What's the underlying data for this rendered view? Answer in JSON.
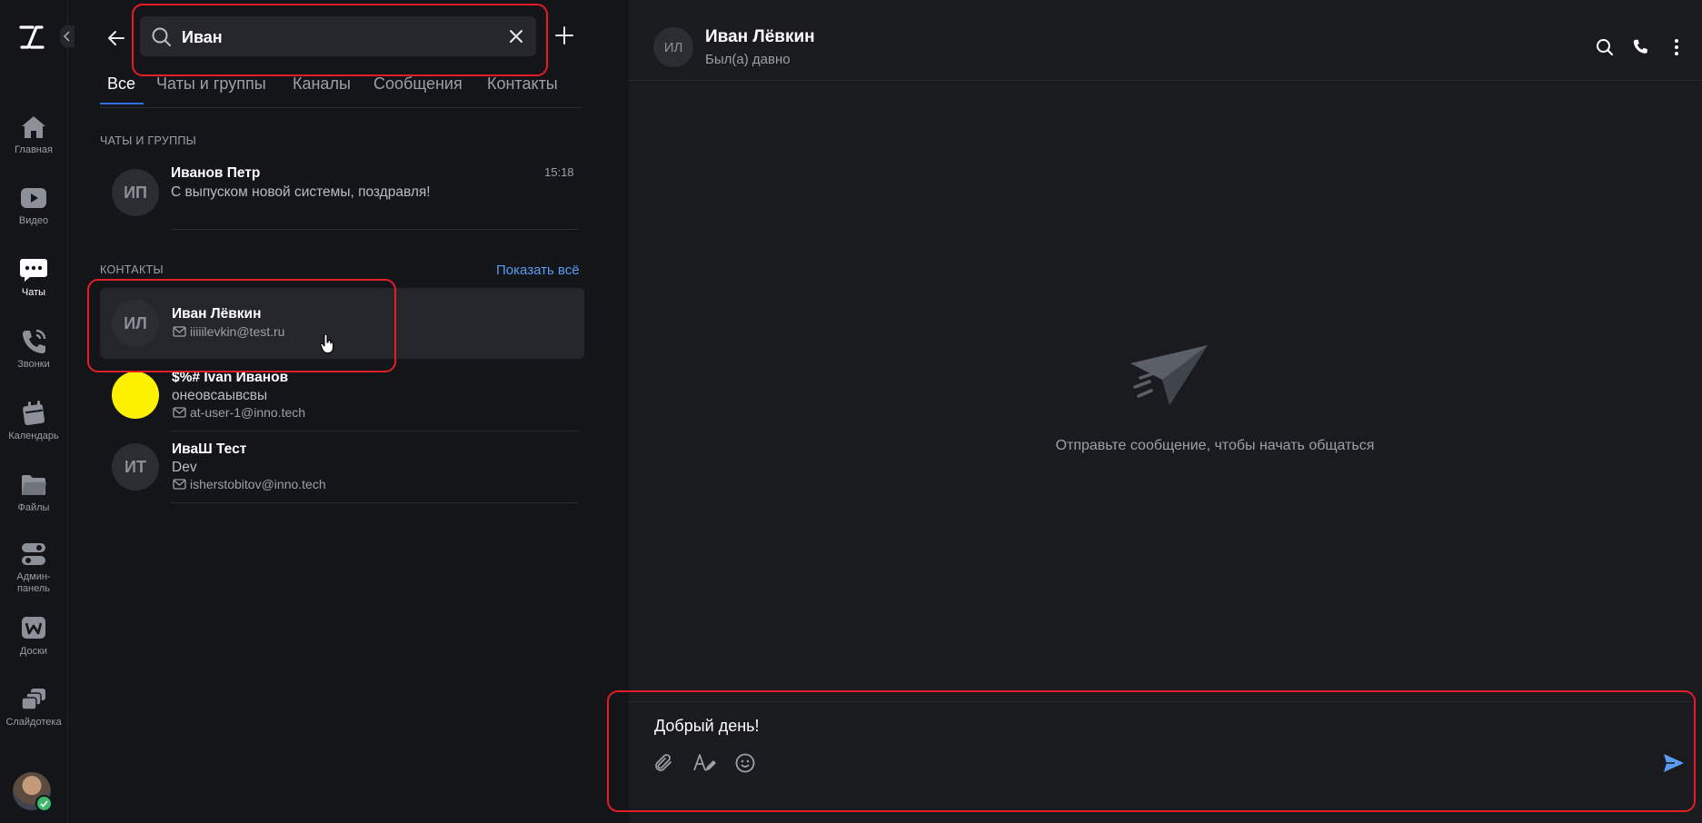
{
  "rail": {
    "items": [
      {
        "label": "Главная",
        "icon": "home-icon"
      },
      {
        "label": "Видео",
        "icon": "video-icon"
      },
      {
        "label": "Чаты",
        "icon": "chat-icon"
      },
      {
        "label": "Звонки",
        "icon": "phone-icon"
      },
      {
        "label": "Календарь",
        "icon": "calendar-icon"
      },
      {
        "label": "Файлы",
        "icon": "folder-icon"
      },
      {
        "label": "Админ-\nпанель",
        "icon": "admin-toggle-icon"
      },
      {
        "label": "Доски",
        "icon": "whiteboard-icon"
      },
      {
        "label": "Слайдотека",
        "icon": "slides-icon"
      }
    ],
    "active_index": 2
  },
  "search": {
    "value": "Иван"
  },
  "tabs": [
    "Все",
    "Чаты и группы",
    "Каналы",
    "Сообщения",
    "Контакты"
  ],
  "sections": {
    "chats_title": "ЧАТЫ И ГРУППЫ",
    "contacts_title": "КОНТАКТЫ",
    "show_all": "Показать всё"
  },
  "chats": [
    {
      "initials": "ИП",
      "name": "Иванов Петр",
      "preview": "С выпуском новой системы, поздравля!",
      "time": "15:18"
    }
  ],
  "contacts": [
    {
      "initials": "ИЛ",
      "name": "Иван Лёвкин",
      "sub": "",
      "email": "iiiiilevkin@test.ru"
    },
    {
      "initials": "",
      "name": "$%# Ivan Иванов",
      "sub": "онеовсаывсвы",
      "email": "at-user-1@inno.tech"
    },
    {
      "initials": "ИТ",
      "name": "ИваШ Тест",
      "sub": "Dev",
      "email": "isherstobitov@inno.tech"
    }
  ],
  "chat": {
    "initials": "ИЛ",
    "title": "Иван Лёвкин",
    "status": "Был(а) давно",
    "empty_text": "Отправьте сообщение, чтобы начать общаться"
  },
  "composer": {
    "value": "Добрый день!"
  },
  "colors": {
    "accent": "#2f6ee5",
    "link": "#5b9cf5",
    "highlight_frame": "#e31e24",
    "online": "#3dba6e",
    "yellow_avatar": "#fff200"
  }
}
